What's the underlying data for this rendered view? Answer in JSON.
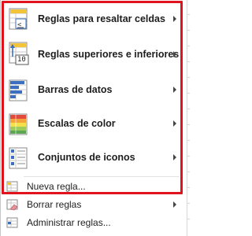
{
  "menu": {
    "items": [
      {
        "id": "highlight",
        "label": "Reglas para resaltar celdas",
        "icon": "highlight-cells-rules-icon",
        "submenu": true
      },
      {
        "id": "topbottom",
        "label": "Reglas superiores e inferiores",
        "icon": "top-bottom-rules-icon",
        "icon_text": "10",
        "submenu": true
      },
      {
        "id": "databars",
        "label": "Barras de datos",
        "icon": "data-bars-icon",
        "submenu": true
      },
      {
        "id": "colorscales",
        "label": "Escalas de color",
        "icon": "color-scales-icon",
        "submenu": true
      },
      {
        "id": "iconsets",
        "label": "Conjuntos de iconos",
        "icon": "icon-sets-icon",
        "submenu": true
      },
      {
        "id": "newrule",
        "label": "Nueva regla...",
        "icon": "new-rule-icon",
        "submenu": false
      },
      {
        "id": "clearrules",
        "label": "Borrar reglas",
        "icon": "clear-rules-icon",
        "submenu": true
      },
      {
        "id": "managerules",
        "label": "Administrar reglas...",
        "icon": "manage-rules-icon",
        "submenu": false
      }
    ],
    "colors": {
      "highlight_border": "#e0141d",
      "icon_blue": "#3a6fc1",
      "icon_yellow": "#f3c33a",
      "icon_red": "#e24b3b",
      "icon_green": "#5aa651"
    }
  }
}
